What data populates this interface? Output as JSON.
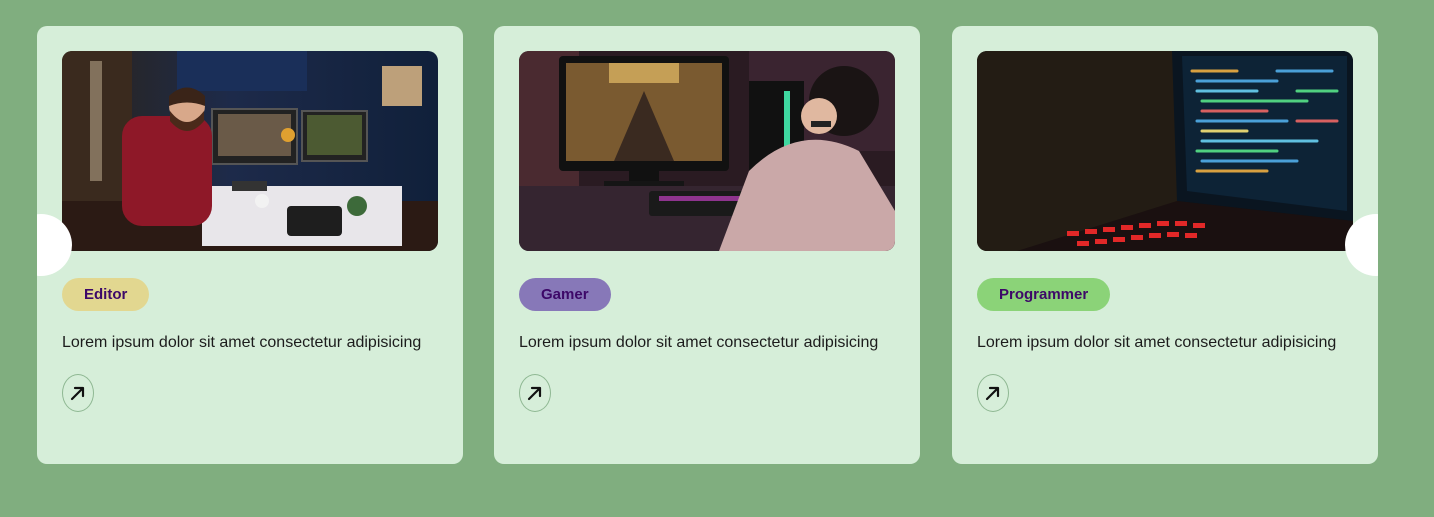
{
  "cards": [
    {
      "tag": "Editor",
      "tag_color": "#e2d790",
      "description": "Lorem ipsum dolor sit amet consectetur adipisicing",
      "image": "video-editor-at-desk-photo"
    },
    {
      "tag": "Gamer",
      "tag_color": "#8778b8",
      "description": "Lorem ipsum dolor sit amet consectetur adipisicing",
      "image": "gamer-playing-fps-photo"
    },
    {
      "tag": "Programmer",
      "tag_color": "#8bd378",
      "description": "Lorem ipsum dolor sit amet consectetur adipisicing",
      "image": "laptop-with-code-photo"
    }
  ],
  "icons": {
    "card_action": "arrow-up-right-icon",
    "prev": "carousel-prev-button",
    "next": "carousel-next-button"
  },
  "colors": {
    "background": "#80ae7f",
    "card": "#d6eed9",
    "tag_text": "#3d0868"
  }
}
